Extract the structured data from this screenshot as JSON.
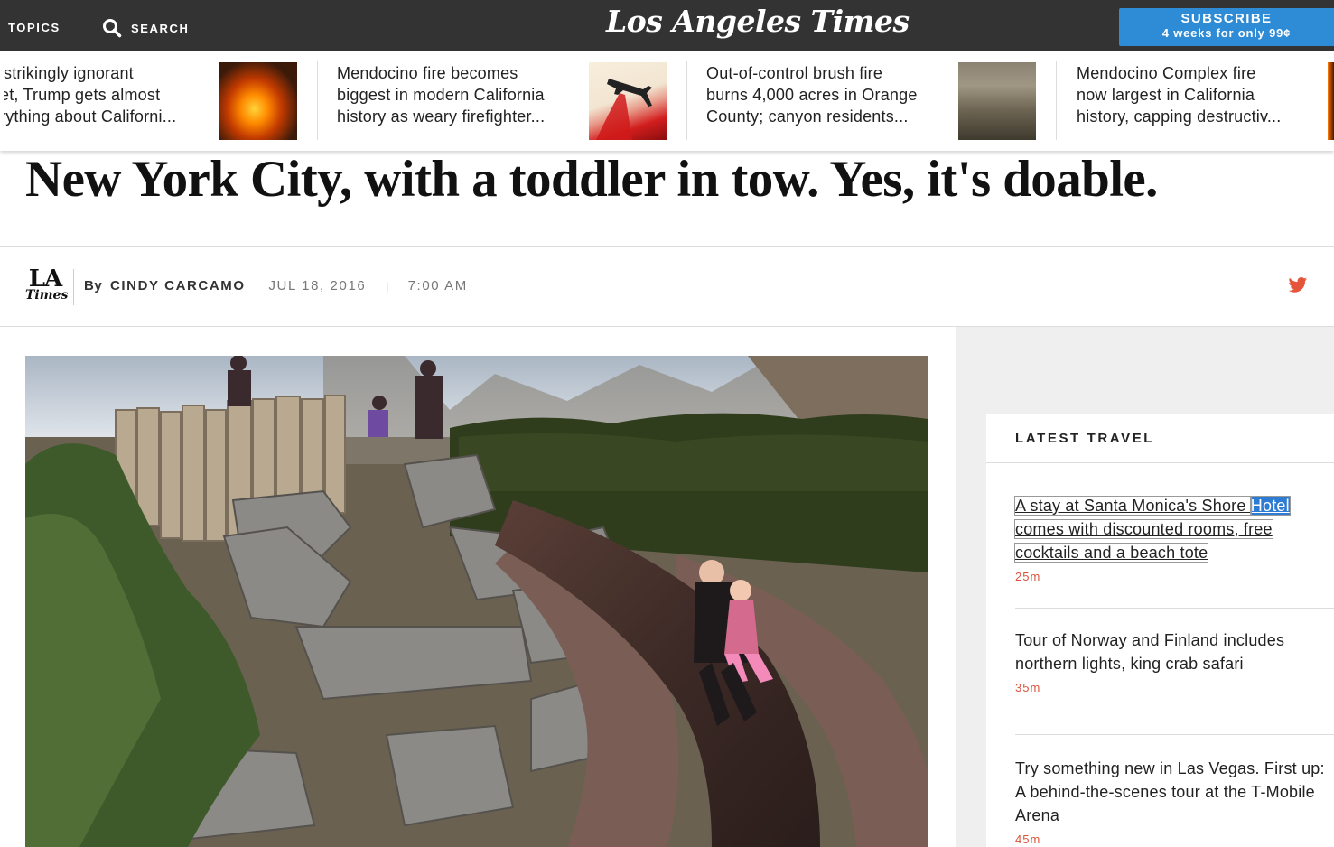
{
  "nav": {
    "topics_label": "TOPICS",
    "search_label": "SEARCH",
    "logo": "Los Angeles Times",
    "subscribe_title": "SUBSCRIBE",
    "subscribe_offer": "4 weeks for only 99¢"
  },
  "strip": [
    {
      "text": [
        "strikingly ignorant",
        "et, Trump gets almost",
        "rything about Californi..."
      ],
      "thumb": "fire-photo"
    },
    {
      "text": [
        "Mendocino fire becomes",
        "biggest in modern California",
        "history as weary firefighter..."
      ],
      "thumb": "air-tanker-photo"
    },
    {
      "text": [
        "Out-of-control brush fire",
        "burns 4,000 acres in Orange",
        "County; canyon residents..."
      ],
      "thumb": "smoke-photo"
    },
    {
      "text": [
        "Mendocino Complex fire",
        "now largest in California",
        "history, capping destructiv..."
      ],
      "thumb": "fire-photo"
    }
  ],
  "article": {
    "headline": "New York City, with a toddler in tow. Yes, it's doable.",
    "logo_top": "LA",
    "logo_bottom": "Times",
    "by": "By",
    "author": "CINDY CARCAMO",
    "date": "JUL 18, 2016",
    "separator": "|",
    "time": "7:00 AM",
    "photo_icon": "playground-slide-photo"
  },
  "rail": {
    "title": "LATEST TRAVEL",
    "items": [
      {
        "text_before": "A stay at Santa Monica's Shore ",
        "text_highlight": "Hotel",
        "text_after": "comes with discounted rooms, free cocktails and a beach tote",
        "ago": "25m"
      },
      {
        "text": "Tour of Norway and Finland includes northern lights, king crab safari",
        "ago": "35m"
      },
      {
        "text": "Try something new in Las Vegas. First up: A behind-the-scenes tour at the T-Mobile Arena",
        "ago": "45m"
      }
    ]
  },
  "colors": {
    "topbar": "#333333",
    "subscribe": "#2e8bd6",
    "timestamp": "#d9533b",
    "twitter": "#e4553b",
    "selection": "#2e7bd4"
  }
}
